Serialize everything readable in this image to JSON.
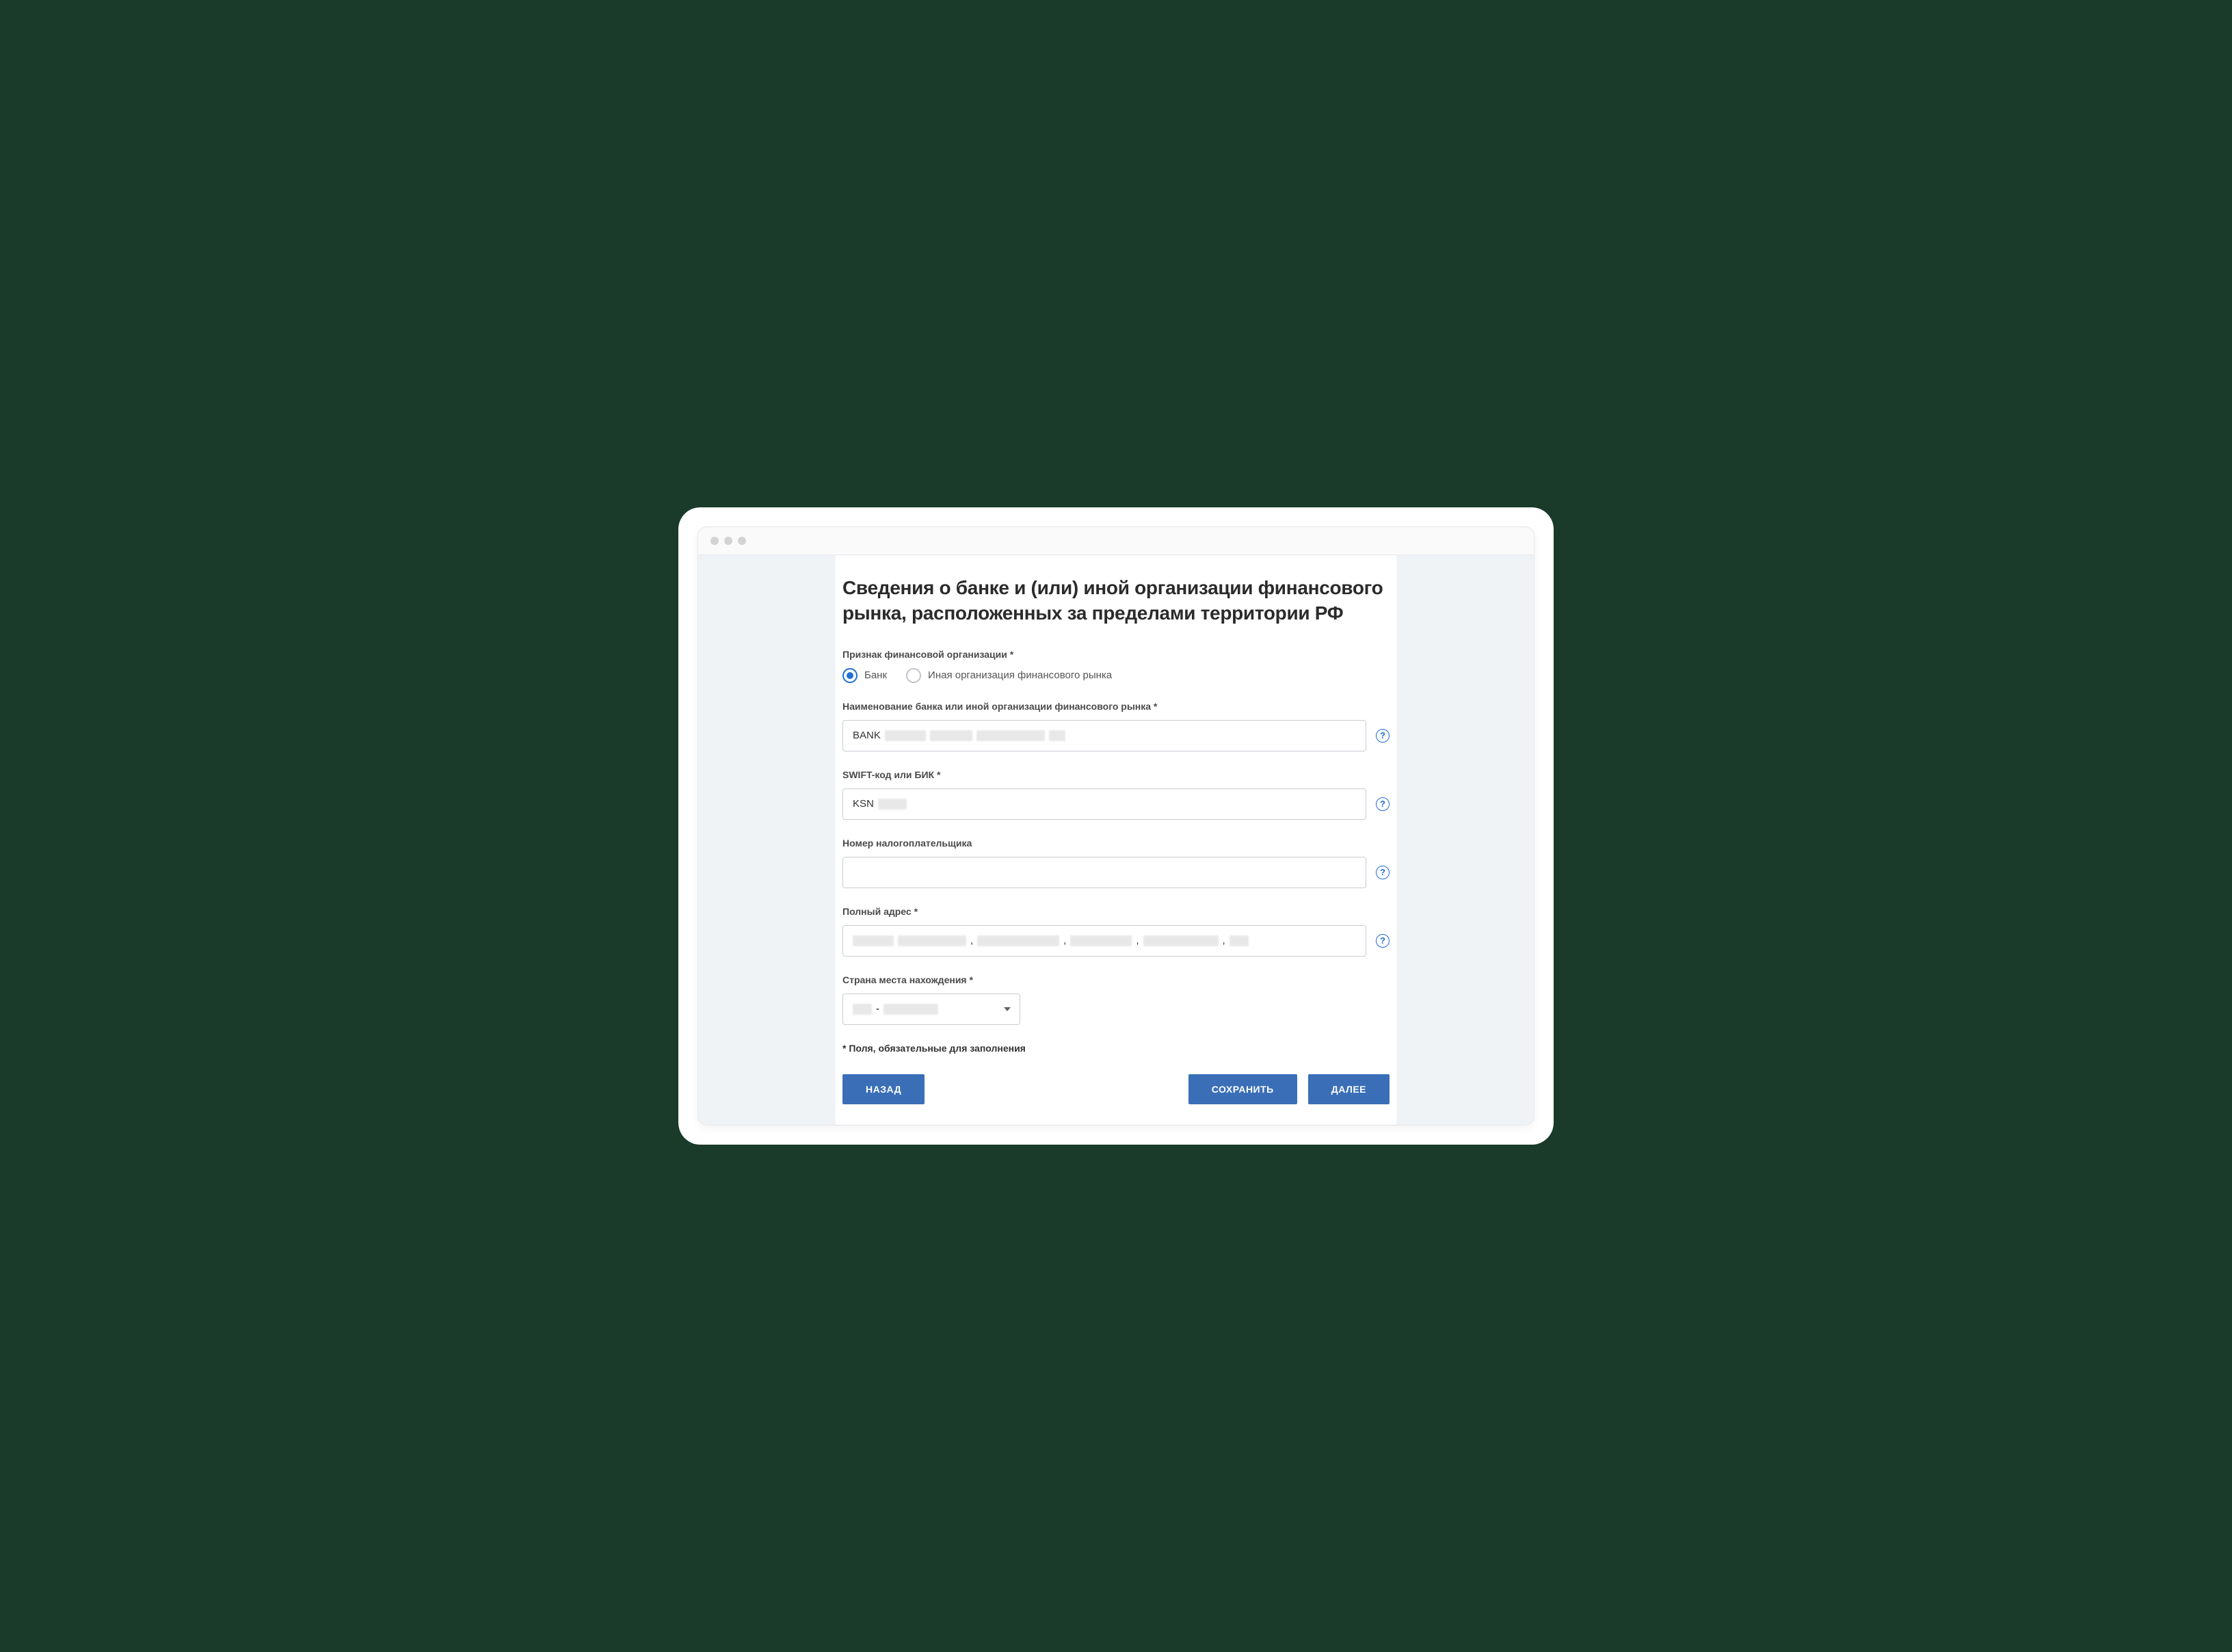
{
  "title": "Сведения о банке и (или) иной организации финансового рынка, расположенных  за пределами территории РФ",
  "orgTypeLabel": "Признак финансовой организации *",
  "radioBank": "Банк",
  "radioOther": "Иная организация финансового рынка",
  "fields": {
    "name": {
      "label": "Наименование банка или иной организации финансового рынка *",
      "valuePrefix": "BANK"
    },
    "swift": {
      "label": "SWIFT-код или БИК *",
      "valuePrefix": "KSN"
    },
    "taxpayer": {
      "label": "Номер налогоплательщика"
    },
    "address": {
      "label": "Полный адрес *"
    },
    "country": {
      "label": "Страна места нахождения *",
      "sep": " - "
    }
  },
  "footnote": "* Поля, обязательные для заполнения",
  "buttons": {
    "back": "НАЗАД",
    "save": "СОХРАНИТЬ",
    "next": "ДАЛЕЕ"
  },
  "help": "?"
}
